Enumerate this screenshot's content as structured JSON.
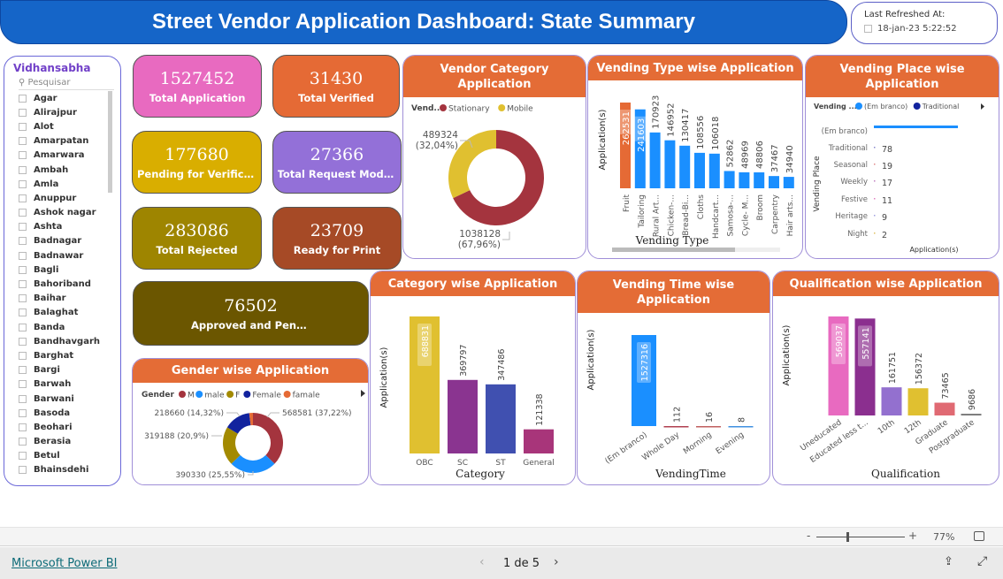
{
  "header": {
    "title": "Street Vendor Application Dashboard: State Summary",
    "refresh_label": "Last Refreshed At:",
    "refresh_value": "18-jan-23 5:22:52"
  },
  "slicer": {
    "title": "Vidhansabha",
    "search_placeholder": "Pesquisar",
    "items": [
      "Agar",
      "Alirajpur",
      "Alot",
      "Amarpatan",
      "Amarwara",
      "Ambah",
      "Amla",
      "Anuppur",
      "Ashok nagar",
      "Ashta",
      "Badnagar",
      "Badnawar",
      "Bagli",
      "Bahoriband",
      "Baihar",
      "Balaghat",
      "Banda",
      "Bandhavgarh",
      "Barghat",
      "Bargi",
      "Barwah",
      "Barwani",
      "Basoda",
      "Beohari",
      "Berasia",
      "Betul",
      "Bhainsdehi"
    ]
  },
  "kpis": [
    {
      "value": "1527452",
      "label": "Total Application",
      "color": "#e86ac0"
    },
    {
      "value": "31430",
      "label": "Total Verified",
      "color": "#e56a35"
    },
    {
      "value": "177680",
      "label": "Pending for Verification",
      "color": "#d9ae00"
    },
    {
      "value": "27366",
      "label": "Total Request Modification",
      "color": "#9370d8"
    },
    {
      "value": "283086",
      "label": "Total Rejected",
      "color": "#9e8500"
    },
    {
      "value": "23709",
      "label": "Ready for Print",
      "color": "#a64a26"
    },
    {
      "value": "76502",
      "label": "Approved and Pending for Signature",
      "color": "#6b5600"
    }
  ],
  "chart_data": [
    {
      "id": "vendor_category",
      "type": "pie",
      "donut": true,
      "title": "Vendor Category Application",
      "legend_title": "Vend...",
      "legend_placement": "top-left",
      "categories": [
        "Stationary",
        "Mobile"
      ],
      "values": [
        1038128,
        489324
      ],
      "labels": [
        "1038128",
        "489324"
      ],
      "percent_labels": [
        "(67,96%)",
        "(32,04%)"
      ],
      "colors": [
        "#a4343e",
        "#e0c030"
      ]
    },
    {
      "id": "vending_type",
      "type": "bar",
      "title": "Vending Type wise Application",
      "xlabel": "Vending Type",
      "ylabel": "Application(s)",
      "categories": [
        "Fruit",
        "Tailoring",
        "Rural Art...",
        "Chicken-...",
        "Bread-Bi...",
        "Cloths",
        "Handcart...",
        "Samosa-...",
        "Cycle- M...",
        "Broom",
        "Carpentry",
        "Hair arts..."
      ],
      "values": [
        262531,
        241603,
        170923,
        146952,
        130417,
        108556,
        106018,
        52862,
        48969,
        48806,
        37467,
        34940
      ],
      "colors": [
        "#e56a35",
        "#1a8fff",
        "#1a8fff",
        "#1a8fff",
        "#1a8fff",
        "#1a8fff",
        "#1a8fff",
        "#1a8fff",
        "#1a8fff",
        "#1a8fff",
        "#1a8fff",
        "#1a8fff"
      ]
    },
    {
      "id": "vending_place",
      "type": "bar",
      "orientation": "horizontal",
      "title": "Vending Place wise Application",
      "legend_title": "Vending ...",
      "legend": [
        "(Em branco)",
        "Traditional"
      ],
      "legend_colors": [
        "#1a8fff",
        "#12239e"
      ],
      "xlabel": "Application(s)",
      "ylabel": "Vending Place",
      "categories": [
        "(Em branco)",
        "Traditional",
        "Seasonal",
        "Weekly",
        "Festive",
        "Heritage",
        "Night"
      ],
      "values": [
        null,
        78,
        19,
        17,
        11,
        9,
        2
      ],
      "colors": [
        "#1a8fff",
        "#8888cc",
        "#e08888",
        "#c080c0",
        "#e080c0",
        "#a0a0e0",
        "#e0c060"
      ]
    },
    {
      "id": "gender",
      "type": "pie",
      "donut": true,
      "title": "Gender wise Application",
      "legend_title": "Gender",
      "legend_placement": "top-left",
      "categories": [
        "M",
        "male",
        "F",
        "Female",
        "famale"
      ],
      "values": [
        568581,
        390330,
        319188,
        218660,
        null
      ],
      "labels": [
        "568581 (37,22%)",
        "390330 (25,55%)",
        "319188 (20,9%)",
        "218660 (14,32%)",
        ""
      ],
      "percents": [
        37.22,
        25.55,
        20.9,
        14.32,
        null
      ],
      "colors": [
        "#a4343e",
        "#1a8fff",
        "#a38a00",
        "#12239e",
        "#e56a35"
      ]
    },
    {
      "id": "category",
      "type": "bar",
      "title": "Category wise Application",
      "xlabel": "Category",
      "ylabel": "Application(s)",
      "categories": [
        "OBC",
        "SC",
        "ST",
        "General"
      ],
      "values": [
        688831,
        369797,
        347486,
        121338
      ],
      "colors": [
        "#e0c030",
        "#8a3490",
        "#4050b0",
        "#a8357a"
      ]
    },
    {
      "id": "vending_time",
      "type": "bar",
      "title": "Vending Time wise Application",
      "xlabel": "VendingTime",
      "ylabel": "Application(s)",
      "categories": [
        "(Em branco)",
        "Whole Day",
        "Morning",
        "Evening"
      ],
      "values": [
        1527316,
        112,
        16,
        8
      ],
      "colors": [
        "#1a8fff",
        "#b04050",
        "#c06060",
        "#4090e0"
      ]
    },
    {
      "id": "qualification",
      "type": "bar",
      "title": "Qualification wise Application",
      "xlabel": "Qualification",
      "ylabel": "Application(s)",
      "categories": [
        "Uneducated",
        "Educated less t...",
        "10th",
        "12th",
        "Graduate",
        "Postgraduate"
      ],
      "values": [
        569037,
        557141,
        161751,
        156372,
        73465,
        9686
      ],
      "colors": [
        "#e86ac0",
        "#8b2f8f",
        "#9370cf",
        "#e0c030",
        "#e06a73",
        "#777777"
      ]
    }
  ],
  "footer": {
    "zoom": "77%",
    "zoom_minus": "-",
    "zoom_plus": "+",
    "brand": "Microsoft Power BI",
    "page": "1 de 5"
  }
}
